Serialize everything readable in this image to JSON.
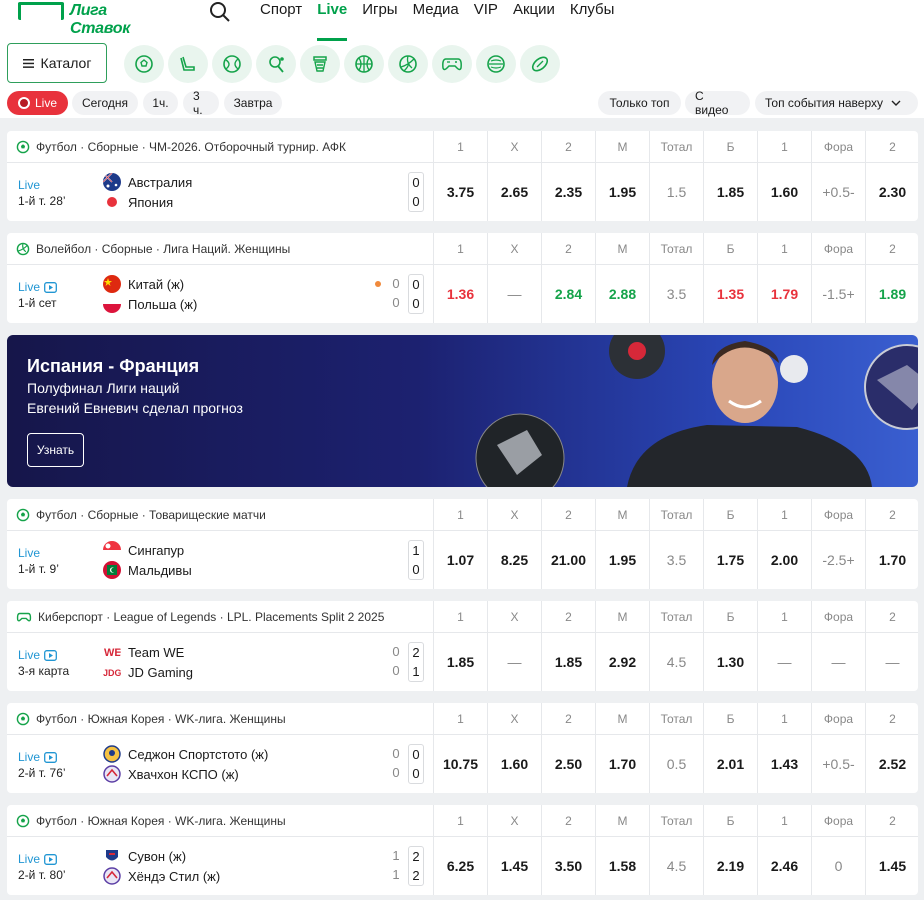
{
  "header": {
    "logo_text": "Лига Ставок",
    "nav": [
      "Спорт",
      "Live",
      "Игры",
      "Медиа",
      "VIP",
      "Акции",
      "Клубы"
    ],
    "active_nav": "Live"
  },
  "catalog": {
    "label": "Каталог"
  },
  "sport_icons": [
    "soccer-icon",
    "hockey-icon",
    "tennis-icon",
    "table-tennis-icon",
    "basketball-icon",
    "volleyball-icon",
    "esports-icon",
    "baseball-icon",
    "rugby-icon"
  ],
  "filters": {
    "live": "Live",
    "today": "Сегодня",
    "h1": "1ч.",
    "h3": "3 ч.",
    "tomorrow": "Завтра",
    "only_top": "Только топ",
    "with_video": "С видео",
    "sort": "Топ события наверху"
  },
  "odds_header": [
    "1",
    "X",
    "2",
    "М",
    "Тотал",
    "Б",
    "1",
    "Фора",
    "2"
  ],
  "events": [
    {
      "league": "Футбол · Сборные · ЧМ-2026. Отборочный турнир. АФК",
      "live": "Live",
      "time": "1-й т. 28’",
      "video": false,
      "team1": "Австралия",
      "team2": "Япония",
      "score1": "0",
      "score2": "0",
      "odds": [
        "3.75",
        "2.65",
        "2.35",
        "1.95",
        "1.5",
        "1.85",
        "1.60",
        "+0.5-",
        "2.30"
      ]
    },
    {
      "league": "Волейбол · Сборные · Лига Наций. Женщины",
      "live": "Live",
      "time": "1-й сет",
      "video": true,
      "team1": "Китай (ж)",
      "team2": "Польша (ж)",
      "sub1": "0",
      "sub2": "0",
      "score1": "0",
      "score2": "0",
      "odds": [
        "1.36",
        "—",
        "2.84",
        "2.88",
        "3.5",
        "1.35",
        "1.79",
        "-1.5+",
        "1.89"
      ]
    },
    {
      "league": "Футбол · Сборные · Товарищеские матчи",
      "live": "Live",
      "time": "1-й т. 9’",
      "video": false,
      "team1": "Сингапур",
      "team2": "Мальдивы",
      "score1": "1",
      "score2": "0",
      "odds": [
        "1.07",
        "8.25",
        "21.00",
        "1.95",
        "3.5",
        "1.75",
        "2.00",
        "-2.5+",
        "1.70"
      ]
    },
    {
      "league": "Киберспорт · League of Legends · LPL. Placements Split 2 2025",
      "live": "Live",
      "time": "3-я карта",
      "video": true,
      "team1": "Team WE",
      "team2": "JD Gaming",
      "sub1": "0",
      "sub2": "0",
      "score1": "2",
      "score2": "1",
      "odds": [
        "1.85",
        "—",
        "1.85",
        "2.92",
        "4.5",
        "1.30",
        "—",
        "—",
        "—"
      ]
    },
    {
      "league": "Футбол · Южная Корея · WK-лига. Женщины",
      "live": "Live",
      "time": "2-й т. 76’",
      "video": true,
      "team1": "Седжон Спортстото (ж)",
      "team2": "Хвачхон КСПО (ж)",
      "sub1": "0",
      "sub2": "0",
      "score1": "0",
      "score2": "0",
      "odds": [
        "10.75",
        "1.60",
        "2.50",
        "1.70",
        "0.5",
        "2.01",
        "1.43",
        "+0.5-",
        "2.52"
      ]
    },
    {
      "league": "Футбол · Южная Корея · WK-лига. Женщины",
      "live": "Live",
      "time": "2-й т. 80’",
      "video": true,
      "team1": "Сувон (ж)",
      "team2": "Хёндэ Стил (ж)",
      "sub1": "1",
      "sub2": "1",
      "score1": "2",
      "score2": "2",
      "odds": [
        "6.25",
        "1.45",
        "3.50",
        "1.58",
        "4.5",
        "2.19",
        "2.46",
        "0",
        "1.45"
      ]
    }
  ],
  "banner": {
    "title": "Испания - Франция",
    "line1": "Полуфинал Лиги наций",
    "line2": "Евгений Евневич сделал прогноз",
    "button": "Узнать"
  },
  "colors": {
    "brand": "#00a14b",
    "live_red": "#e8323c",
    "live_blue": "#2196d3",
    "odd_up": "#15a34a",
    "odd_down": "#e8323c"
  }
}
